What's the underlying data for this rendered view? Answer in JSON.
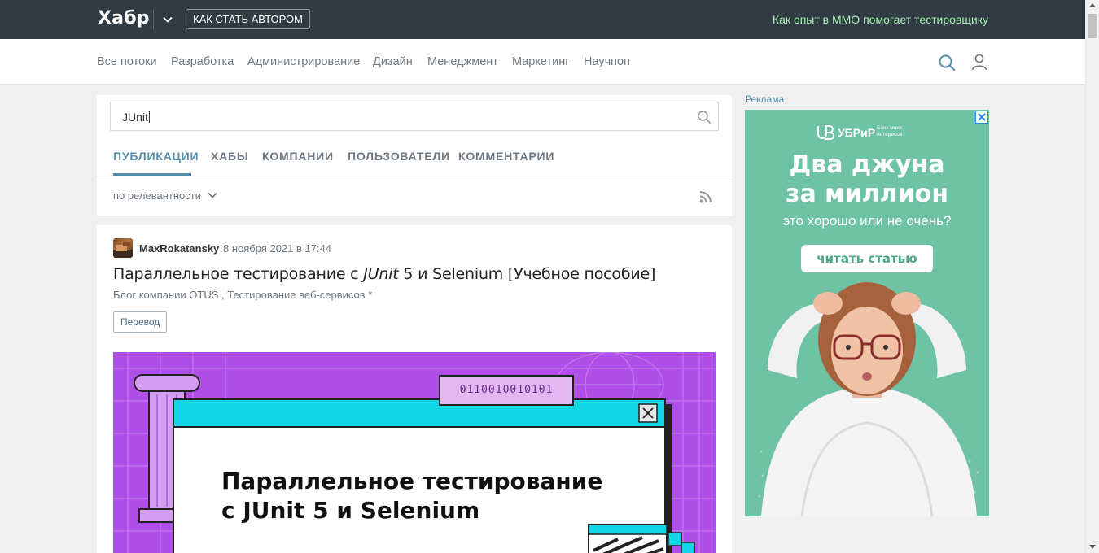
{
  "header": {
    "logo": "Хабр",
    "author_button": "КАК СТАТЬ АВТОРОМ",
    "promo_link": "Как опыт в ММО помогает тестировщику",
    "promo_color": "#a8ecb0",
    "background": "#303b44"
  },
  "nav": {
    "items": [
      "Все потоки",
      "Разработка",
      "Администрирование",
      "Дизайн",
      "Менеджмент",
      "Маркетинг",
      "Научпоп"
    ],
    "icons": [
      "search-icon",
      "user-icon"
    ]
  },
  "search": {
    "value": "JUnit",
    "tabs": [
      "ПУБЛИКАЦИИ",
      "ХАБЫ",
      "КОМПАНИИ",
      "ПОЛЬЗОВАТЕЛИ",
      "КОММЕНТАРИИ"
    ],
    "active_tab": "ПУБЛИКАЦИИ",
    "sort": "по релевантности",
    "accent": "#548eaa"
  },
  "article": {
    "author": "MaxRokatansky",
    "date": "8 ноября 2021 в 17:44",
    "title_before": "Параллельное тестирование с ",
    "title_highlight": "JUnit",
    "title_after": " 5 и Selenium [Учебное пособие]",
    "hubs": "Блог компании OTUS , Тестирование веб-сервисов *",
    "label": "Перевод",
    "cover": {
      "binary": "0110010010101",
      "heading_line1": "Параллельное тестирование",
      "heading_line2": "с JUnit 5 и Selenium",
      "background": "#b04ee8"
    }
  },
  "ad": {
    "label": "Реклама",
    "brand": "УБРиР",
    "brand_tagline": "Банк моих интересов",
    "heading_line1": "Два джуна",
    "heading_line2": "за миллион",
    "subheading": "это хорошо или не очень?",
    "button": "читать статью",
    "background": "#6fc3a5"
  }
}
